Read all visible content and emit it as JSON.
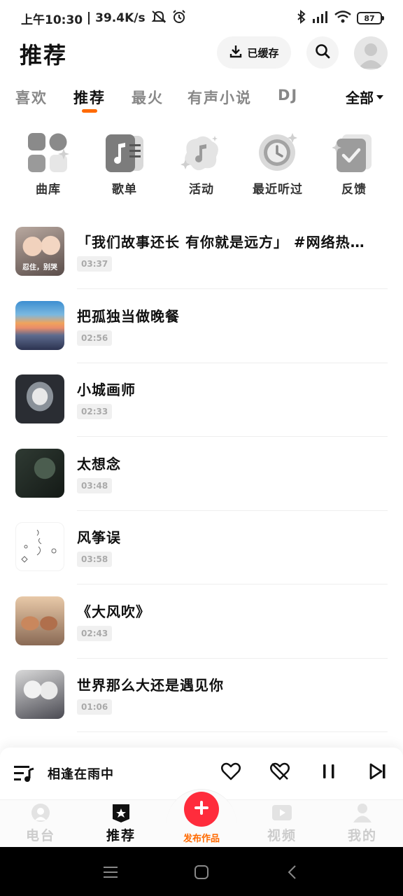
{
  "status_bar": {
    "time": "上午10:30",
    "network_speed": "39.4K/s",
    "battery": "87"
  },
  "header": {
    "title": "推荐",
    "cached_label": "已缓存"
  },
  "tabs": {
    "items": [
      "喜欢",
      "推荐",
      "最火",
      "有声小说",
      "DJ"
    ],
    "active": "推荐",
    "all_label": "全部"
  },
  "quick_actions": [
    {
      "label": "曲库",
      "icon": "grid-icon"
    },
    {
      "label": "歌单",
      "icon": "playlist-icon"
    },
    {
      "label": "活动",
      "icon": "activity-icon"
    },
    {
      "label": "最近听过",
      "icon": "recent-clock-icon"
    },
    {
      "label": "反馈",
      "icon": "feedback-icon"
    }
  ],
  "songs": [
    {
      "title": "「我们故事还长 有你就是远方」 #网络热…",
      "duration": "03:37",
      "cover_text": "忍住，别哭"
    },
    {
      "title": "把孤独当做晚餐",
      "duration": "02:56"
    },
    {
      "title": "小城画师",
      "duration": "02:33"
    },
    {
      "title": "太想念",
      "duration": "03:48"
    },
    {
      "title": "风筝误",
      "duration": "03:58"
    },
    {
      "title": "《大风吹》",
      "duration": "02:43"
    },
    {
      "title": "世界那么大还是遇见你",
      "duration": "01:06"
    }
  ],
  "player": {
    "now_playing": "相逢在雨中"
  },
  "nav": {
    "radio": "电台",
    "recommend": "推荐",
    "publish": "发布作品",
    "video": "视频",
    "mine": "我的"
  },
  "colors": {
    "accent_orange": "#ff6a00",
    "publish_red": "#ff2c3c"
  }
}
